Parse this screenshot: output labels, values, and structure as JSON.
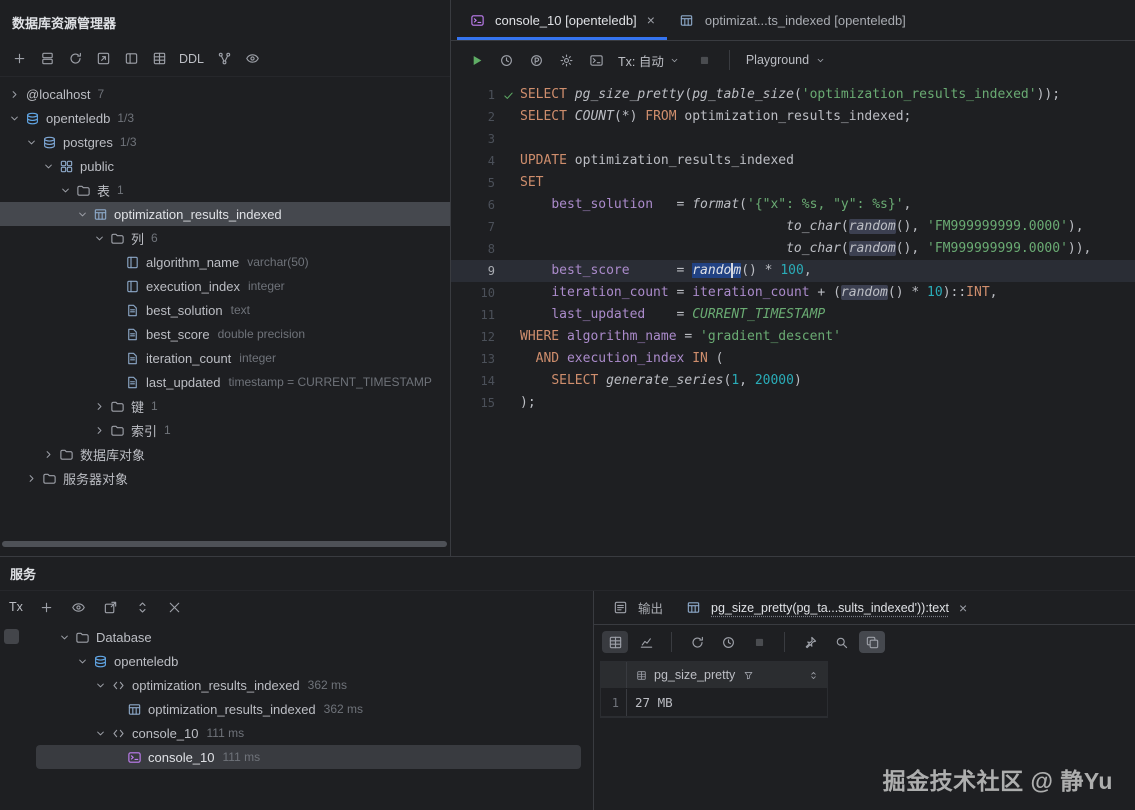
{
  "app": {
    "watermark": "掘金技术社区 @ 静Yu"
  },
  "explorer": {
    "title": "数据库资源管理器",
    "toolbar": {
      "items": [
        {
          "icon": "plus",
          "name": "add-datasource-button"
        },
        {
          "icon": "layers",
          "name": "datasource-properties-button"
        },
        {
          "icon": "refresh",
          "name": "refresh-button"
        },
        {
          "icon": "jump",
          "name": "jump-to-ddl-button"
        },
        {
          "icon": "panels",
          "name": "layout-button"
        },
        {
          "icon": "grid",
          "name": "open-table-button"
        },
        {
          "label": "DDL",
          "name": "ddl-button"
        },
        {
          "icon": "diagram",
          "name": "diagram-button"
        },
        {
          "icon": "eye",
          "name": "view-options-button"
        }
      ]
    },
    "tree": [
      {
        "depth": 0,
        "chevron": "right",
        "label": "@localhost",
        "badge": "7"
      },
      {
        "depth": 0,
        "chevron": "down",
        "icon": "postgres",
        "label": "openteledb",
        "badge": "1/3"
      },
      {
        "depth": 1,
        "chevron": "down",
        "icon": "database",
        "label": "postgres",
        "badge": "1/3"
      },
      {
        "depth": 2,
        "chevron": "down",
        "icon": "schema",
        "label": "public"
      },
      {
        "depth": 3,
        "chevron": "down",
        "icon": "folder",
        "label": "表",
        "badge": "1"
      },
      {
        "depth": 4,
        "chevron": "down",
        "icon": "table",
        "label": "optimization_results_indexed",
        "selected": true
      },
      {
        "depth": 5,
        "chevron": "down",
        "icon": "folder",
        "label": "列",
        "badge": "6"
      },
      {
        "depth": 6,
        "icon": "column",
        "label": "algorithm_name",
        "meta": "varchar(50)"
      },
      {
        "depth": 6,
        "icon": "column",
        "label": "execution_index",
        "meta": "integer"
      },
      {
        "depth": 6,
        "icon": "column-doc",
        "label": "best_solution",
        "meta": "text"
      },
      {
        "depth": 6,
        "icon": "column-doc",
        "label": "best_score",
        "meta": "double precision"
      },
      {
        "depth": 6,
        "icon": "column-doc",
        "label": "iteration_count",
        "meta": "integer"
      },
      {
        "depth": 6,
        "icon": "column-doc",
        "label": "last_updated",
        "meta": "timestamp = CURRENT_TIMESTAMP"
      },
      {
        "depth": 5,
        "chevron": "right",
        "icon": "folder",
        "label": "键",
        "badge": "1"
      },
      {
        "depth": 5,
        "chevron": "right",
        "icon": "folder",
        "label": "索引",
        "badge": "1"
      },
      {
        "depth": 2,
        "chevron": "right",
        "icon": "folder",
        "label": "数据库对象"
      },
      {
        "depth": 1,
        "chevron": "right",
        "icon": "folder",
        "label": "服务器对象"
      }
    ]
  },
  "editor": {
    "tabs": [
      {
        "icon": "console",
        "label": "console_10 [openteledb]",
        "active": true,
        "close": "×"
      },
      {
        "icon": "table",
        "label": "optimizat...ts_indexed [openteledb]",
        "active": false
      }
    ],
    "toolbar": {
      "items": [
        {
          "icon": "run",
          "name": "run-button"
        },
        {
          "icon": "history",
          "name": "execution-history-button"
        },
        {
          "icon": "profiler",
          "name": "explain-plan-button"
        },
        {
          "icon": "settings",
          "name": "settings-button"
        },
        {
          "icon": "terminal",
          "name": "open-console-button"
        },
        {
          "label": "Tx: 自动",
          "chevron": true,
          "name": "tx-mode-select"
        },
        {
          "icon": "stop",
          "disabled": true,
          "name": "stop-button"
        },
        {
          "divider": true
        },
        {
          "label": "Playground",
          "chevron": true,
          "name": "playground-select"
        }
      ]
    },
    "lines": [
      {
        "num": "1",
        "mark": "check",
        "segs": [
          [
            "k",
            "SELECT"
          ],
          [
            "p",
            " "
          ],
          [
            "f",
            "pg_size_pretty"
          ],
          [
            "p",
            "("
          ],
          [
            "f",
            "pg_table_size"
          ],
          [
            "p",
            "("
          ],
          [
            "s",
            "'optimization_results_indexed'"
          ],
          [
            "p",
            "));"
          ]
        ]
      },
      {
        "num": "2",
        "segs": [
          [
            "k",
            "SELECT"
          ],
          [
            "p",
            " "
          ],
          [
            "f",
            "COUNT"
          ],
          [
            "p",
            "(*) "
          ],
          [
            "k",
            "FROM"
          ],
          [
            "p",
            " optimization_results_indexed;"
          ]
        ]
      },
      {
        "num": "3",
        "segs": []
      },
      {
        "num": "4",
        "segs": [
          [
            "k",
            "UPDATE"
          ],
          [
            "p",
            " optimization_results_indexed"
          ]
        ]
      },
      {
        "num": "5",
        "segs": [
          [
            "k",
            "SET"
          ]
        ]
      },
      {
        "num": "6",
        "segs": [
          [
            "p",
            "    "
          ],
          [
            "c",
            "best_solution"
          ],
          [
            "p",
            "   = "
          ],
          [
            "f",
            "format"
          ],
          [
            "p",
            "("
          ],
          [
            "s",
            "'{\"x\": %s, \"y\": %s}'"
          ],
          [
            "p",
            ","
          ]
        ]
      },
      {
        "num": "7",
        "segs": [
          [
            "p",
            "                                  "
          ],
          [
            "f",
            "to_char"
          ],
          [
            "p",
            "("
          ],
          [
            "f occ",
            "random"
          ],
          [
            "p",
            "(), "
          ],
          [
            "s",
            "'FM999999999.0000'"
          ],
          [
            "p",
            "),"
          ]
        ]
      },
      {
        "num": "8",
        "segs": [
          [
            "p",
            "                                  "
          ],
          [
            "f",
            "to_char"
          ],
          [
            "p",
            "("
          ],
          [
            "f occ",
            "random"
          ],
          [
            "p",
            "(), "
          ],
          [
            "s",
            "'FM999999999.0000'"
          ],
          [
            "p",
            ")),"
          ]
        ]
      },
      {
        "num": "9",
        "current": true,
        "segs": [
          [
            "p",
            "    "
          ],
          [
            "c",
            "best_score"
          ],
          [
            "p",
            "      = "
          ],
          [
            "f sel",
            "rando"
          ],
          [
            "caret",
            ""
          ],
          [
            "f sel",
            "m"
          ],
          [
            "p",
            "() * "
          ],
          [
            "n",
            "100"
          ],
          [
            "p",
            ","
          ]
        ]
      },
      {
        "num": "10",
        "segs": [
          [
            "p",
            "    "
          ],
          [
            "c",
            "iteration_count"
          ],
          [
            "p",
            " = "
          ],
          [
            "c",
            "iteration_count"
          ],
          [
            "p",
            " + ("
          ],
          [
            "f occ",
            "random"
          ],
          [
            "p",
            "() * "
          ],
          [
            "n",
            "10"
          ],
          [
            "p",
            ")::"
          ],
          [
            "k",
            "INT"
          ],
          [
            "p",
            ","
          ]
        ]
      },
      {
        "num": "11",
        "segs": [
          [
            "p",
            "    "
          ],
          [
            "c",
            "last_updated"
          ],
          [
            "p",
            "    = "
          ],
          [
            "t",
            "CURRENT_TIMESTAMP"
          ]
        ]
      },
      {
        "num": "12",
        "segs": [
          [
            "k",
            "WHERE"
          ],
          [
            "p",
            " "
          ],
          [
            "c",
            "algorithm_name"
          ],
          [
            "p",
            " = "
          ],
          [
            "s",
            "'gradient_descent'"
          ]
        ]
      },
      {
        "num": "13",
        "segs": [
          [
            "p",
            "  "
          ],
          [
            "k",
            "AND"
          ],
          [
            "p",
            " "
          ],
          [
            "c",
            "execution_index"
          ],
          [
            "p",
            " "
          ],
          [
            "k",
            "IN"
          ],
          [
            "p",
            " ("
          ]
        ]
      },
      {
        "num": "14",
        "segs": [
          [
            "p",
            "    "
          ],
          [
            "k",
            "SELECT"
          ],
          [
            "p",
            " "
          ],
          [
            "f",
            "generate_series"
          ],
          [
            "p",
            "("
          ],
          [
            "n",
            "1"
          ],
          [
            "p",
            ", "
          ],
          [
            "n",
            "20000"
          ],
          [
            "p",
            ")"
          ]
        ]
      },
      {
        "num": "15",
        "segs": [
          [
            "p",
            ");"
          ]
        ]
      }
    ]
  },
  "services": {
    "title": "服务",
    "toolbar": {
      "items": [
        {
          "label": "Tx",
          "name": "tx-filter"
        },
        {
          "icon": "plus",
          "name": "add-service-button"
        },
        {
          "icon": "eye",
          "name": "view-options-button"
        },
        {
          "icon": "open-new",
          "name": "open-in-new-button"
        },
        {
          "icon": "updown",
          "name": "expand-all-button"
        },
        {
          "icon": "collapse",
          "name": "collapse-all-button"
        }
      ]
    },
    "tree": [
      {
        "depth": 0,
        "chevron": "down",
        "icon": "folder",
        "label": "Database"
      },
      {
        "depth": 1,
        "chevron": "down",
        "icon": "postgres",
        "label": "openteledb"
      },
      {
        "depth": 2,
        "chevron": "down",
        "icon": "query",
        "label": "optimization_results_indexed",
        "meta": "362 ms"
      },
      {
        "depth": 3,
        "icon": "table",
        "label": "optimization_results_indexed",
        "meta": "362 ms"
      },
      {
        "depth": 2,
        "chevron": "down",
        "icon": "query",
        "label": "console_10",
        "meta": "111 ms"
      },
      {
        "depth": 3,
        "icon": "console",
        "label": "console_10",
        "meta": "111 ms",
        "selected": true
      }
    ]
  },
  "results": {
    "tabs": [
      {
        "icon": "output",
        "label": "输出",
        "active": false
      },
      {
        "icon": "table",
        "label": "pg_size_pretty(pg_ta...sults_indexed')):text",
        "active": true,
        "close": "×"
      }
    ],
    "toolbar": {
      "items": [
        {
          "icon": "grid",
          "active": true,
          "name": "grid-view-button"
        },
        {
          "icon": "chart",
          "name": "chart-view-button"
        },
        {
          "divider": true
        },
        {
          "icon": "refresh",
          "name": "reload-button"
        },
        {
          "icon": "history",
          "name": "history-button"
        },
        {
          "icon": "stop",
          "disabled": true,
          "name": "stop-button"
        },
        {
          "divider": true
        },
        {
          "icon": "pin",
          "name": "pin-tab-button"
        },
        {
          "icon": "search",
          "name": "search-button"
        },
        {
          "icon": "export",
          "hl": true,
          "name": "export-button"
        }
      ]
    },
    "grid": {
      "header": "pg_size_pretty",
      "rows": [
        {
          "num": "1",
          "value": "27 MB"
        }
      ]
    }
  }
}
